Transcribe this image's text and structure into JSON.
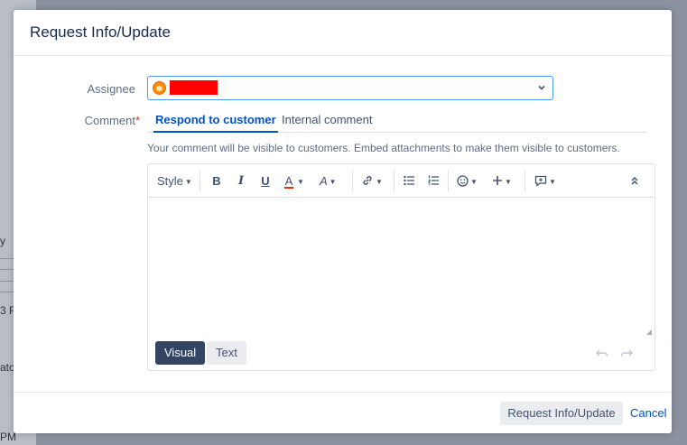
{
  "background": {
    "fragments": [
      "y",
      "3 F",
      "ato",
      "PM"
    ]
  },
  "dialog": {
    "title": "Request Info/Update",
    "assignee": {
      "label": "Assignee",
      "value": ""
    },
    "comment": {
      "label": "Comment",
      "required_mark": "*",
      "tabs": [
        {
          "label": "Respond to customer",
          "active": true
        },
        {
          "label": "Internal comment",
          "active": false
        }
      ],
      "hint": "Your comment will be visible to customers. Embed attachments to make them visible to customers.",
      "toolbar": {
        "style_label": "Style",
        "bold_label": "B",
        "italic_label": "I",
        "underline_label": "U",
        "textcolor_label": "A",
        "format_label": "A",
        "link_glyph": "🔗",
        "bullet_glyph": "☰",
        "numbered_glyph": "☷",
        "emoji_glyph": "☺",
        "insert_glyph": "+",
        "macro_glyph": "⊞",
        "collapse_glyph": "⌃"
      },
      "body": "",
      "modes": [
        {
          "label": "Visual",
          "active": true
        },
        {
          "label": "Text",
          "active": false
        }
      ]
    },
    "footer": {
      "submit_label": "Request Info/Update",
      "cancel_label": "Cancel"
    }
  },
  "colors": {
    "accent": "#0052cc",
    "required": "#de350b",
    "visual_active": "#344563"
  }
}
